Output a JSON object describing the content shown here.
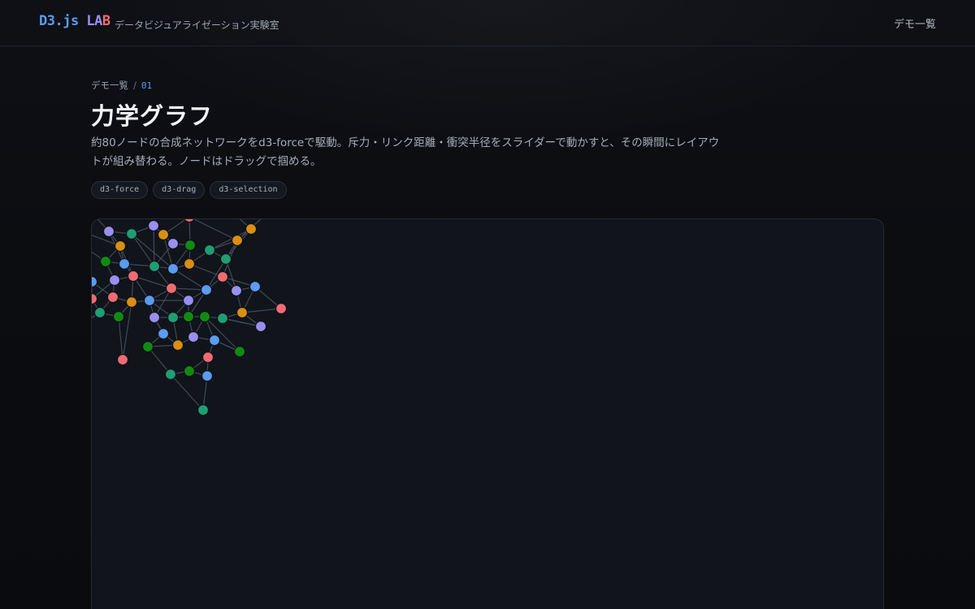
{
  "header": {
    "logo_part1": "D3.js ",
    "logo_part2": "LA",
    "logo_part3": "B",
    "subtitle": "データビジュアライゼーション実験室",
    "nav_link": "デモ一覧"
  },
  "breadcrumb": {
    "home": "デモ一覧",
    "separator": "/",
    "current": "01"
  },
  "page": {
    "title": "力学グラフ",
    "description": "約80ノードの合成ネットワークをd3-forceで駆動。斥力・リンク距離・衝突半径をスライダーで動かすと、その瞬間にレイアウトが組み替わる。ノードはドラッグで掴める。",
    "tags": [
      "d3-force",
      "d3-drag",
      "d3-selection"
    ]
  },
  "graph": {
    "group_colors": [
      "#5b9bf0",
      "#9a8ff0",
      "#ef6b73",
      "#d98f12",
      "#1f9e74",
      "#128a12"
    ],
    "link_color": "#4a5060",
    "node_stroke": "#0f1218"
  }
}
